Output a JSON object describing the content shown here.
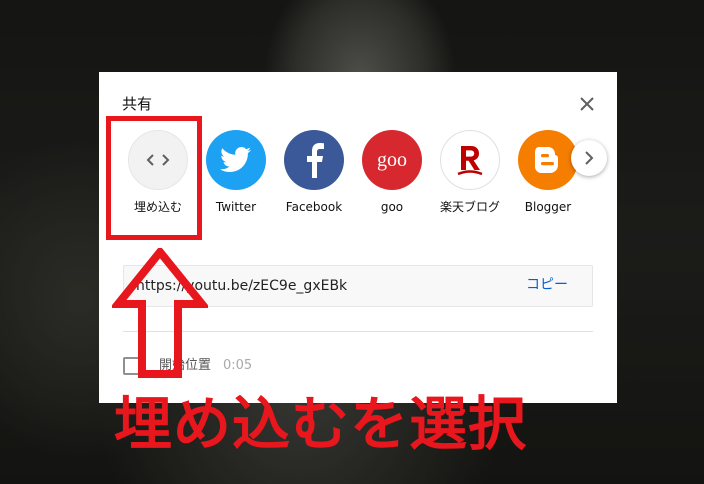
{
  "dialog": {
    "title": "共有"
  },
  "share_targets": [
    {
      "id": "embed",
      "label": "埋め込む",
      "icon": "embed-code-icon",
      "color": "#f2f2f2"
    },
    {
      "id": "twitter",
      "label": "Twitter",
      "icon": "twitter-bird-icon",
      "color": "#1da1f2"
    },
    {
      "id": "facebook",
      "label": "Facebook",
      "icon": "facebook-f-icon",
      "color": "#3b5998"
    },
    {
      "id": "goo",
      "label": "goo",
      "icon": "goo-logo-icon",
      "color": "#d7282f",
      "logo_text": "goo"
    },
    {
      "id": "rakuten",
      "label": "楽天ブログ",
      "icon": "rakuten-r-icon",
      "color": "#ffffff"
    },
    {
      "id": "blogger",
      "label": "Blogger",
      "icon": "blogger-b-icon",
      "color": "#f57d00"
    }
  ],
  "url_box": {
    "url": "https://youtu.be/zEC9e_gxEBk",
    "copy_label": "コピー"
  },
  "start_at": {
    "label": "開始位置",
    "time": "0:05"
  },
  "annotation": {
    "caption": "埋め込むを選択",
    "color": "#e8161d"
  }
}
